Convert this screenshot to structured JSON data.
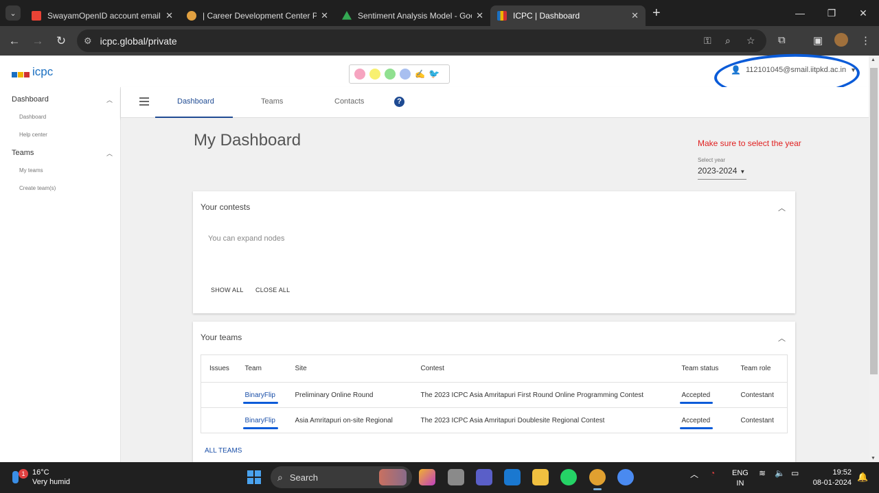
{
  "browser": {
    "tabs": [
      {
        "title": "SwayamOpenID account email",
        "color": "#ea4335",
        "active": false
      },
      {
        "title": "| Career Development Center P",
        "color": "#e0a040",
        "active": false
      },
      {
        "title": "Sentiment Analysis Model - Goo",
        "color": "#34a853",
        "active": false
      },
      {
        "title": "ICPC | Dashboard",
        "color": "#f0b400",
        "active": true
      }
    ],
    "url": "icpc.global/private"
  },
  "header": {
    "logo_text": "icpc",
    "user_email": "112101045@smail.iitpkd.ac.in",
    "palette_colors": [
      "#f6a4c0",
      "#f8f070",
      "#90e090",
      "#a8bff0"
    ]
  },
  "sidebar": {
    "groups": [
      {
        "label": "Dashboard",
        "items": [
          "Dashboard",
          "Help center"
        ]
      },
      {
        "label": "Teams",
        "items": [
          "My teams",
          "Create team(s)"
        ]
      }
    ]
  },
  "nav": {
    "tabs": [
      "Dashboard",
      "Teams",
      "Contacts"
    ],
    "help": "?"
  },
  "main": {
    "title": "My Dashboard",
    "warning": "Make sure to select the year",
    "year_label": "Select year",
    "year_value": "2023-2024",
    "contests": {
      "heading": "Your contests",
      "note": "You can expand nodes",
      "show_all": "SHOW ALL",
      "close_all": "CLOSE ALL"
    },
    "teams": {
      "heading": "Your teams",
      "columns": [
        "Issues",
        "Team",
        "Site",
        "Contest",
        "Team status",
        "Team role"
      ],
      "rows": [
        {
          "issues": "",
          "team": "BinaryFlip",
          "site": "Preliminary Online Round",
          "contest": "The 2023 ICPC Asia Amritapuri First Round Online Programming Contest",
          "status": "Accepted",
          "role": "Contestant"
        },
        {
          "issues": "",
          "team": "BinaryFlip",
          "site": "Asia Amritapuri on-site Regional",
          "contest": "The 2023 ICPC Asia Amritapuri Doublesite Regional Contest",
          "status": "Accepted",
          "role": "Contestant"
        }
      ],
      "all_teams": "ALL TEAMS"
    }
  },
  "taskbar": {
    "weather_temp": "16°C",
    "weather_desc": "Very humid",
    "weather_badge": "1",
    "search": "Search",
    "lang_1": "ENG",
    "lang_2": "IN",
    "time": "19:52",
    "date": "08-01-2024"
  }
}
